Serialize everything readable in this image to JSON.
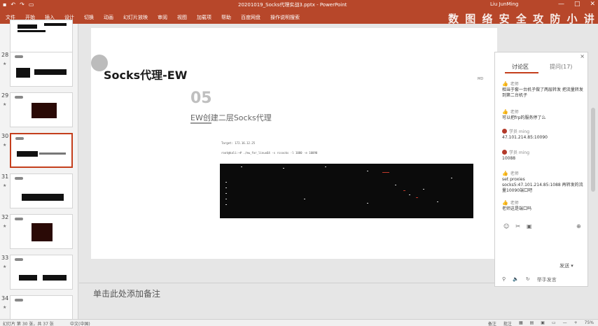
{
  "titlebar": {
    "qat_icons": [
      "save-icon",
      "undo-icon",
      "redo-icon",
      "present-icon"
    ],
    "doc_title": "20201019_Socks代理实战3.pptx - PowerPoint",
    "user": "Liu JunMing",
    "controls": [
      "—",
      "□",
      "✕"
    ]
  },
  "ribbon": {
    "tabs": [
      "文件",
      "开始",
      "插入",
      "设计",
      "切换",
      "动画",
      "幻灯片放映",
      "审阅",
      "视图",
      "加载项",
      "帮助",
      "百度网盘",
      "操作说明搜索"
    ],
    "active_tab": "开始",
    "overlay_title": "数 图 络 安 全 攻 防 小 讲 站"
  },
  "thumbs": [
    {
      "num": "",
      "star": ""
    },
    {
      "num": "28",
      "star": "★"
    },
    {
      "num": "29",
      "star": "★"
    },
    {
      "num": "30",
      "star": "★"
    },
    {
      "num": "31",
      "star": "★"
    },
    {
      "num": "32",
      "star": "★"
    },
    {
      "num": "33",
      "star": "★"
    },
    {
      "num": "34",
      "star": "★"
    }
  ],
  "slide": {
    "heading": "Socks代理-EW",
    "number": "05",
    "subtitle": "EW创建二层Socks代理",
    "cmd1": "Target: 172.16.12.25",
    "cmd2": "root@kali:~# ./ew_for_linux64 -s rcsocks -l 1080 -e 10090",
    "badge": "MD"
  },
  "notes": {
    "placeholder": "单击此处添加备注"
  },
  "panel": {
    "close": "×",
    "tab_active": "讨论区",
    "tab_inactive": "提问(17)",
    "messages": [
      {
        "who": "老师",
        "avatar": "thumb",
        "body": "相当于套一台机子做了两层转发 把流量转发到第二台机子"
      },
      {
        "who": "老师",
        "avatar": "thumb",
        "body": "可以把frp的服务停了么"
      },
      {
        "who": "学员 ming",
        "avatar": "red",
        "body": "47.101.214.85:10090"
      },
      {
        "who": "学员 ming",
        "avatar": "red",
        "body": "10088"
      },
      {
        "who": "老师",
        "avatar": "thumb",
        "body": "set proxies socks5:47.101.214.85:1088 再转发的流量10090端口吧"
      },
      {
        "who": "老师",
        "avatar": "thumb",
        "body": "老师这是端口吗"
      }
    ],
    "tools": [
      "☺",
      "✂",
      "▣"
    ],
    "plus": "⊕",
    "send": "发送 ▾",
    "bottom": [
      "⚲",
      "🔈",
      "↻",
      "举手发言"
    ]
  },
  "status": {
    "left": "幻灯片 第 30 张，共 37 张",
    "lang": "中文(中国)",
    "right": [
      "备注",
      "批注",
      "▦",
      "▤",
      "▣",
      "▭",
      "—",
      "+",
      "75%"
    ]
  }
}
